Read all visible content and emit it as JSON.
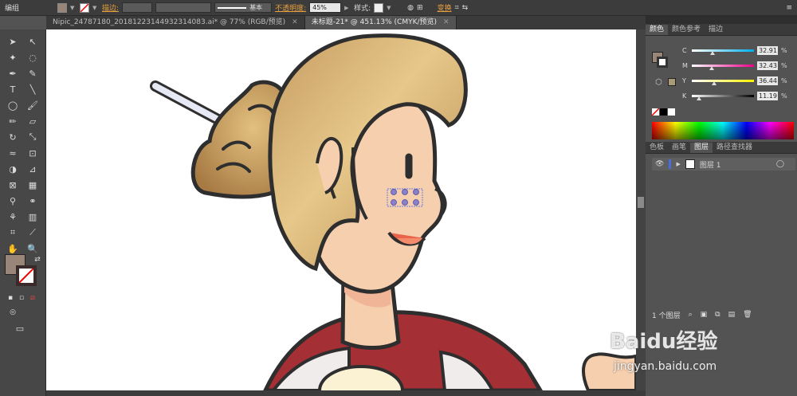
{
  "app": {
    "menu_label": "编组"
  },
  "toolbar": {
    "stroke_label": "描边:",
    "stroke_style": "基本",
    "opacity_label": "不透明度:",
    "opacity_value": "45%",
    "style_label": "样式:",
    "transform_label": "变换"
  },
  "tabs": [
    {
      "label": "Nipic_24787180_20181223144932314083.ai* @ 77% (RGB/预览)"
    },
    {
      "label": "未标题-21* @ 451.13% (CMYK/预览)"
    }
  ],
  "color_panel": {
    "tabs": [
      "颜色",
      "颜色参考",
      "描边"
    ],
    "channels": [
      {
        "label": "C",
        "value": "32.91",
        "level": 0.329
      },
      {
        "label": "M",
        "value": "32.43",
        "level": 0.324
      },
      {
        "label": "Y",
        "value": "36.44",
        "level": 0.364
      },
      {
        "label": "K",
        "value": "11.19",
        "level": 0.112
      }
    ],
    "percent_sign": "%"
  },
  "layers_panel": {
    "tabs": [
      "色板",
      "画笔",
      "图层",
      "路径查找器"
    ],
    "layers": [
      {
        "name": "图层 1"
      }
    ],
    "footer_count": "1 个图层"
  },
  "colors": {
    "fill": "#9a8678",
    "hair": "#c99e62",
    "skin": "#f6cfae",
    "outline": "#2e2e2e",
    "shirt": "#a42f34"
  },
  "watermark": {
    "text": "Baidu经验",
    "url": "jingyan.baidu.com"
  }
}
